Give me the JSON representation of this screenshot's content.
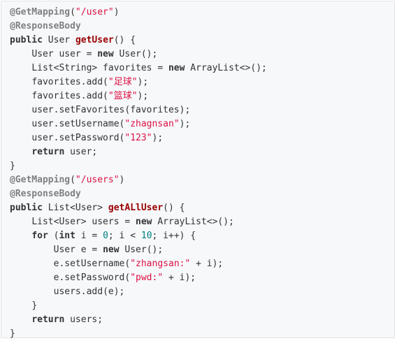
{
  "code": {
    "indent_unit": "    ",
    "colors": {
      "background": "#f6f8fa",
      "annotation": "#808080",
      "keyword": "#333333",
      "function": "#990000",
      "string": "#dd1144",
      "number": "#008080",
      "text": "#333333"
    },
    "lines": [
      {
        "indent": 0,
        "tokens": [
          [
            "annot",
            "@GetMapping"
          ],
          [
            "plain",
            "("
          ],
          [
            "str",
            "\"/user\""
          ],
          [
            "plain",
            ")"
          ]
        ]
      },
      {
        "indent": 0,
        "tokens": [
          [
            "annot",
            "@ResponseBody"
          ]
        ]
      },
      {
        "indent": 0,
        "tokens": [
          [
            "kw",
            "public"
          ],
          [
            "plain",
            " User "
          ],
          [
            "fn",
            "getUser"
          ],
          [
            "plain",
            "() {"
          ]
        ]
      },
      {
        "indent": 1,
        "tokens": [
          [
            "plain",
            "User user = "
          ],
          [
            "kw",
            "new"
          ],
          [
            "plain",
            " User();"
          ]
        ]
      },
      {
        "indent": 1,
        "tokens": [
          [
            "plain",
            "List<String> favorites = "
          ],
          [
            "kw",
            "new"
          ],
          [
            "plain",
            " ArrayList<>();"
          ]
        ]
      },
      {
        "indent": 1,
        "tokens": [
          [
            "plain",
            "favorites.add("
          ],
          [
            "str",
            "\"足球\""
          ],
          [
            "plain",
            ");"
          ]
        ]
      },
      {
        "indent": 1,
        "tokens": [
          [
            "plain",
            "favorites.add("
          ],
          [
            "str",
            "\"篮球\""
          ],
          [
            "plain",
            ");"
          ]
        ]
      },
      {
        "indent": 1,
        "tokens": [
          [
            "plain",
            "user.setFavorites(favorites);"
          ]
        ]
      },
      {
        "indent": 1,
        "tokens": [
          [
            "plain",
            "user.setUsername("
          ],
          [
            "str",
            "\"zhagnsan\""
          ],
          [
            "plain",
            ");"
          ]
        ]
      },
      {
        "indent": 1,
        "tokens": [
          [
            "plain",
            "user.setPassword("
          ],
          [
            "str",
            "\"123\""
          ],
          [
            "plain",
            ");"
          ]
        ]
      },
      {
        "indent": 1,
        "tokens": [
          [
            "kw",
            "return"
          ],
          [
            "plain",
            " user;"
          ]
        ]
      },
      {
        "indent": 0,
        "tokens": [
          [
            "plain",
            "}"
          ]
        ]
      },
      {
        "indent": 0,
        "tokens": [
          [
            "annot",
            "@GetMapping"
          ],
          [
            "plain",
            "("
          ],
          [
            "str",
            "\"/users\""
          ],
          [
            "plain",
            ")"
          ]
        ]
      },
      {
        "indent": 0,
        "tokens": [
          [
            "annot",
            "@ResponseBody"
          ]
        ]
      },
      {
        "indent": 0,
        "tokens": [
          [
            "kw",
            "public"
          ],
          [
            "plain",
            " List<User> "
          ],
          [
            "fn",
            "getALlUser"
          ],
          [
            "plain",
            "() {"
          ]
        ]
      },
      {
        "indent": 1,
        "tokens": [
          [
            "plain",
            "List<User> users = "
          ],
          [
            "kw",
            "new"
          ],
          [
            "plain",
            " ArrayList<>();"
          ]
        ]
      },
      {
        "indent": 1,
        "tokens": [
          [
            "kw",
            "for"
          ],
          [
            "plain",
            " ("
          ],
          [
            "kw",
            "int"
          ],
          [
            "plain",
            " i = "
          ],
          [
            "num",
            "0"
          ],
          [
            "plain",
            "; i < "
          ],
          [
            "num",
            "10"
          ],
          [
            "plain",
            "; i++) {"
          ]
        ]
      },
      {
        "indent": 2,
        "tokens": [
          [
            "plain",
            "User e = "
          ],
          [
            "kw",
            "new"
          ],
          [
            "plain",
            " User();"
          ]
        ]
      },
      {
        "indent": 2,
        "tokens": [
          [
            "plain",
            "e.setUsername("
          ],
          [
            "str",
            "\"zhangsan:\""
          ],
          [
            "plain",
            " + i);"
          ]
        ]
      },
      {
        "indent": 2,
        "tokens": [
          [
            "plain",
            "e.setPassword("
          ],
          [
            "str",
            "\"pwd:\""
          ],
          [
            "plain",
            " + i);"
          ]
        ]
      },
      {
        "indent": 2,
        "tokens": [
          [
            "plain",
            "users.add(e);"
          ]
        ]
      },
      {
        "indent": 1,
        "tokens": [
          [
            "plain",
            "}"
          ]
        ]
      },
      {
        "indent": 1,
        "tokens": [
          [
            "kw",
            "return"
          ],
          [
            "plain",
            " users;"
          ]
        ]
      },
      {
        "indent": 0,
        "tokens": [
          [
            "plain",
            "}"
          ]
        ]
      }
    ]
  }
}
